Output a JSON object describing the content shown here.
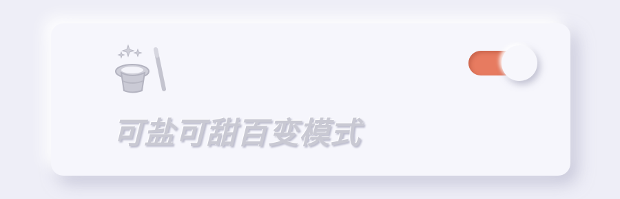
{
  "card": {
    "title": "可盐可甜百变模式",
    "icon": "magic-hat-wand-icon",
    "toggle": {
      "state": "on",
      "accent_color": "#e77b60"
    }
  },
  "colors": {
    "background": "#eeeef7",
    "card": "#f6f6fc",
    "text": "#c9c9d3"
  }
}
